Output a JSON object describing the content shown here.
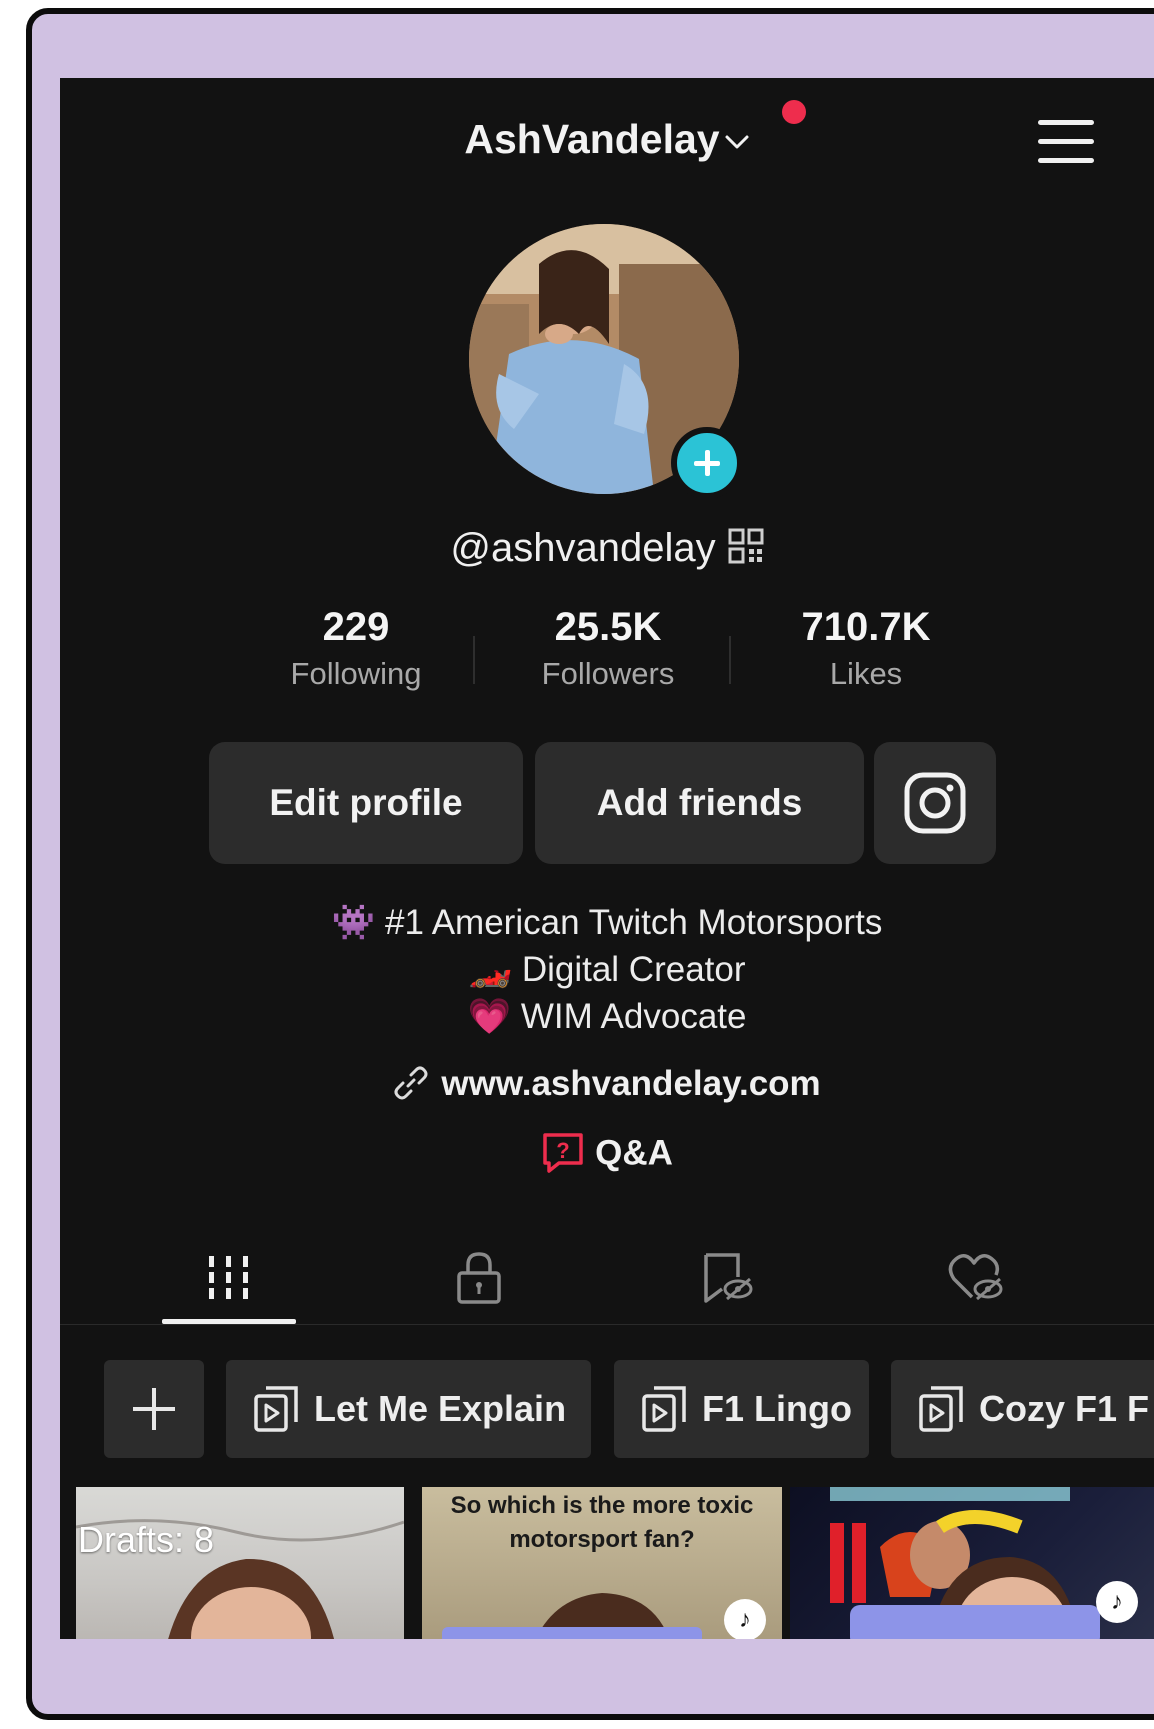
{
  "header": {
    "username_title": "AshVandelay"
  },
  "profile": {
    "handle": "@ashvandelay"
  },
  "stats": [
    {
      "value": "229",
      "label": "Following"
    },
    {
      "value": "25.5K",
      "label": "Followers"
    },
    {
      "value": "710.7K",
      "label": "Likes"
    }
  ],
  "buttons": {
    "edit_profile": "Edit profile",
    "add_friends": "Add friends"
  },
  "bio": {
    "line1": "#1 American Twitch Motorsports",
    "line2": "Digital Creator",
    "line3": "WIM Advocate",
    "emoji1": "👾",
    "emoji2": "🏎️",
    "emoji3": "💗"
  },
  "link": {
    "url": "www.ashvandelay.com"
  },
  "qa": {
    "label": "Q&A"
  },
  "tabs": [
    "videos-grid-icon",
    "lock-icon",
    "saved-hidden-icon",
    "liked-hidden-icon"
  ],
  "playlists": [
    {
      "label": "Let Me Explain"
    },
    {
      "label": "F1 Lingo"
    },
    {
      "label": "Cozy F1 F"
    }
  ],
  "thumbnails": {
    "drafts": "Drafts: 8",
    "caption": "So which is the more toxic motorsport fan?"
  },
  "colors": {
    "background": "#121212",
    "frame": "#d0c1e2",
    "notification": "#ee2d4d",
    "add_avatar": "#2bc3d6",
    "qa_accent": "#ee2d4d",
    "button": "#2c2c2c"
  }
}
